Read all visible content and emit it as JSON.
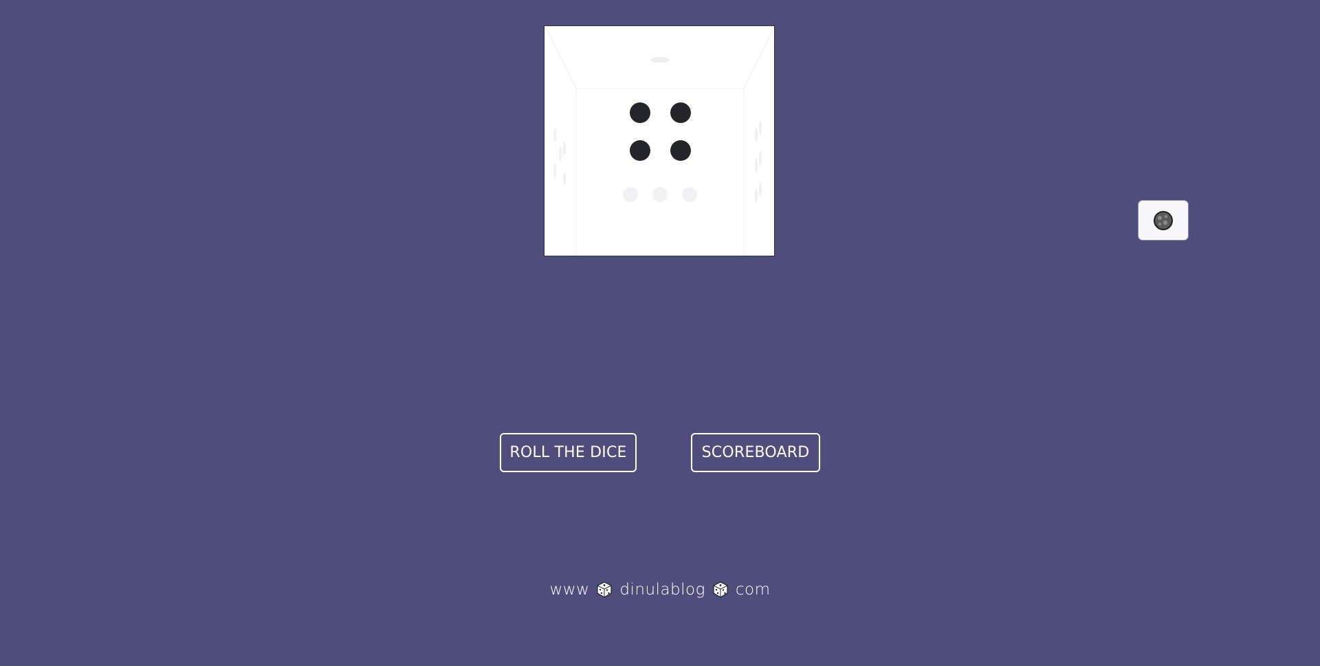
{
  "page": {
    "background_color": "#4f4d7c"
  },
  "die": {
    "face_value": 4,
    "face_color": "#ffffff",
    "pip_color": "#24262b"
  },
  "theme_toggle": {
    "icon": "moon-icon"
  },
  "buttons": {
    "roll_label": "ROLL THE DICE",
    "scoreboard_label": "SCOREBOARD"
  },
  "footer": {
    "part1": "www",
    "part2": "dinulablog",
    "part3": "com",
    "separator_icon": "die-icon"
  }
}
